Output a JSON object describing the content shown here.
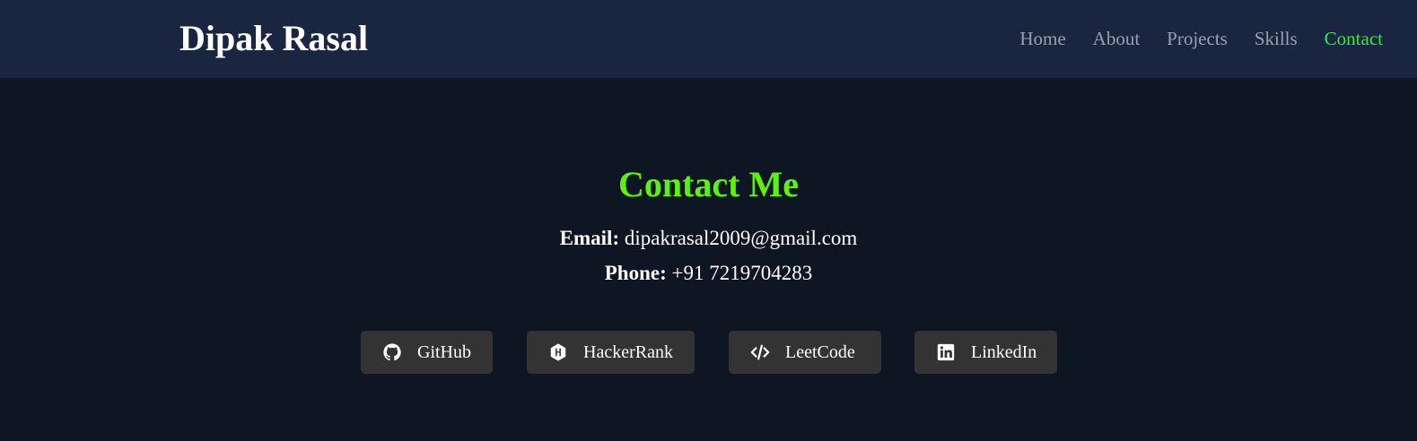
{
  "header": {
    "brand": "Dipak Rasal",
    "nav": [
      {
        "label": "Home"
      },
      {
        "label": "About"
      },
      {
        "label": "Projects"
      },
      {
        "label": "Skills"
      },
      {
        "label": "Contact",
        "active": true
      }
    ],
    "active_color": "#39e63c"
  },
  "contact": {
    "title": "Contact Me",
    "title_color": "#5cf20a",
    "email_label": "Email:",
    "email_value": "dipakrasal2009@gmail.com",
    "phone_label": "Phone:",
    "phone_value": "+91 7219704283",
    "links": [
      {
        "label": "GitHub",
        "icon": "github-icon"
      },
      {
        "label": "HackerRank",
        "icon": "hackerrank-icon"
      },
      {
        "label": "LeetCode",
        "icon": "code-icon"
      },
      {
        "label": "LinkedIn",
        "icon": "linkedin-icon"
      }
    ]
  }
}
